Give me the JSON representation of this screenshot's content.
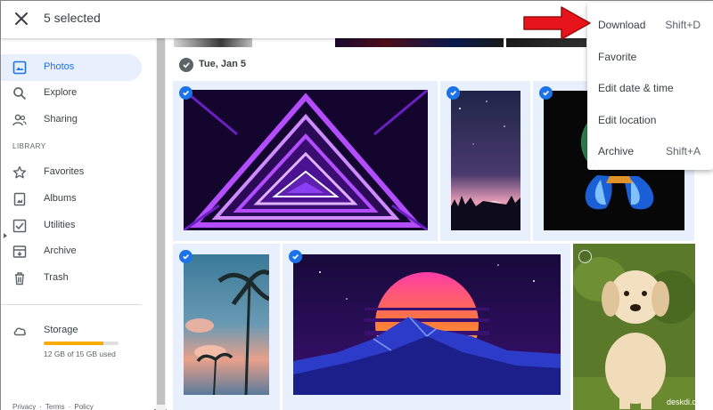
{
  "topbar": {
    "selected_label": "5 selected"
  },
  "sidebar": {
    "items": [
      {
        "label": "Photos",
        "icon": "photo-icon",
        "active": true
      },
      {
        "label": "Explore",
        "icon": "search-icon"
      },
      {
        "label": "Sharing",
        "icon": "people-icon"
      }
    ],
    "library_label": "LIBRARY",
    "library_items": [
      {
        "label": "Favorites",
        "icon": "star-icon"
      },
      {
        "label": "Albums",
        "icon": "album-icon"
      },
      {
        "label": "Utilities",
        "icon": "utilities-icon"
      },
      {
        "label": "Archive",
        "icon": "archive-icon"
      },
      {
        "label": "Trash",
        "icon": "trash-icon"
      }
    ],
    "storage": {
      "label": "Storage",
      "used_text": "12 GB of 15 GB used",
      "fraction": 0.8
    },
    "footer_links": [
      "Privacy",
      "·",
      "Terms",
      "·",
      "Policy"
    ]
  },
  "main": {
    "date_label": "Tue, Jan 5"
  },
  "menu": {
    "items": [
      {
        "label": "Download",
        "shortcut": "Shift+D"
      },
      {
        "label": "Favorite",
        "shortcut": ""
      },
      {
        "label": "Edit date & time",
        "shortcut": ""
      },
      {
        "label": "Edit location",
        "shortcut": ""
      },
      {
        "label": "Archive",
        "shortcut": "Shift+A"
      }
    ]
  },
  "watermark": "deskdi.com",
  "colors": {
    "accent": "#1a73e8",
    "active_bg": "#e8f0fe",
    "storage_bar": "#f9ab00",
    "arrow": "#e8141b"
  }
}
